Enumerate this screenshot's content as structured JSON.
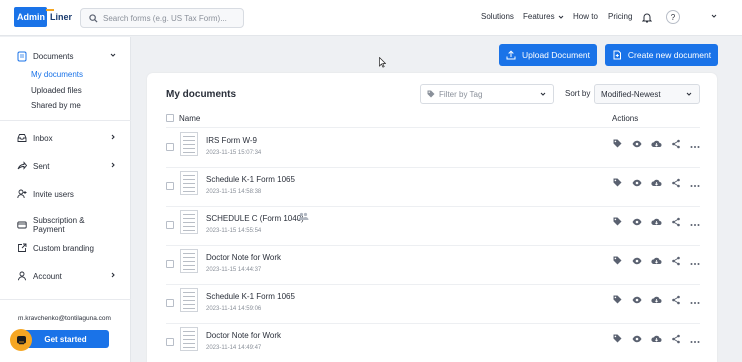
{
  "logo": {
    "part1": "Admin",
    "part2": "Liner"
  },
  "search": {
    "placeholder": "Search forms (e.g. US Tax Form)..."
  },
  "nav": {
    "solutions": "Solutions",
    "features": "Features",
    "howto": "How to",
    "pricing": "Pricing",
    "help": "?"
  },
  "sidebar": {
    "documents": "Documents",
    "sub": [
      "My documents",
      "Uploaded files",
      "Shared by me"
    ],
    "inbox": "Inbox",
    "sent": "Sent",
    "invite": "Invite users",
    "subscription": "Subscription & Payment",
    "branding": "Custom branding",
    "account": "Account",
    "email": "m.kravchenko@tontilaguna.com",
    "get_started": "Get started"
  },
  "buttons": {
    "upload": "Upload Document",
    "create": "Create new document"
  },
  "main": {
    "title": "My documents",
    "filter_placeholder": "Filter by Tag",
    "sort_label": "Sort by",
    "sort_value": "Modified-Newest",
    "col_name": "Name",
    "col_actions": "Actions"
  },
  "documents": [
    {
      "title": "IRS Form W-9",
      "date": "2023-11-15 15:07:34",
      "shared": false
    },
    {
      "title": "Schedule K-1 Form 1065",
      "date": "2023-11-15 14:58:38",
      "shared": false
    },
    {
      "title": "SCHEDULE C (Form 1040)",
      "date": "2023-11-15 14:55:54",
      "shared": true
    },
    {
      "title": "Doctor Note for Work",
      "date": "2023-11-15 14:44:37",
      "shared": false
    },
    {
      "title": "Schedule K-1 Form 1065",
      "date": "2023-11-14 14:59:06",
      "shared": false
    },
    {
      "title": "Doctor Note for Work",
      "date": "2023-11-14 14:49:47",
      "shared": false
    }
  ],
  "colors": {
    "accent": "#1a73e8",
    "logo_orange": "#f5a623",
    "background": "#eef0f3"
  }
}
